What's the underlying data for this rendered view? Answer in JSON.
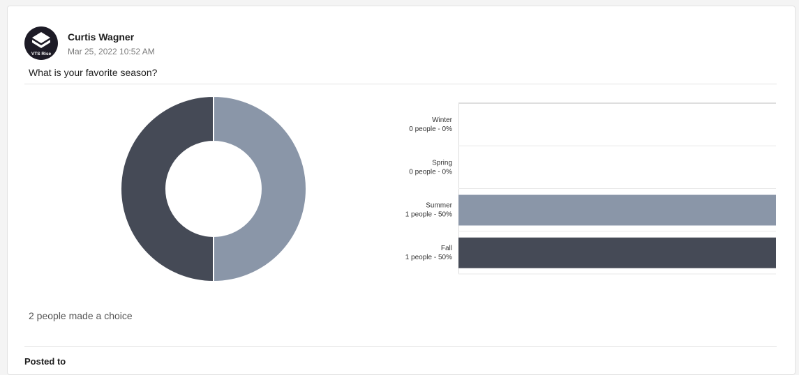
{
  "post": {
    "author": "Curtis Wagner",
    "timestamp": "Mar 25, 2022 10:52 AM",
    "avatar_text": "VTS Rise",
    "question": "What is your favorite season?",
    "summary": "2 people made a choice",
    "posted_to_label": "Posted to"
  },
  "colors": {
    "summer": "#8a96a8",
    "fall": "#454a56",
    "avatar_bg": "#1d1b26"
  },
  "chart_data": {
    "type": "bar",
    "orientation": "horizontal",
    "categories": [
      "Winter",
      "Spring",
      "Summer",
      "Fall"
    ],
    "values": [
      0,
      0,
      1,
      1
    ],
    "percents": [
      0,
      0,
      50,
      50
    ],
    "sub_labels": [
      "0 people - 0%",
      "0 people - 0%",
      "1 people - 50%",
      "1 people - 50%"
    ],
    "colors": [
      "#b9bfc9",
      "#b9bfc9",
      "#8a96a8",
      "#454a56"
    ],
    "xlim": [
      0,
      1
    ],
    "grid": true
  },
  "donut_data": {
    "type": "pie",
    "labels": [
      "Summer",
      "Fall"
    ],
    "values": [
      1,
      1
    ],
    "colors": [
      "#8a96a8",
      "#454a56"
    ]
  }
}
